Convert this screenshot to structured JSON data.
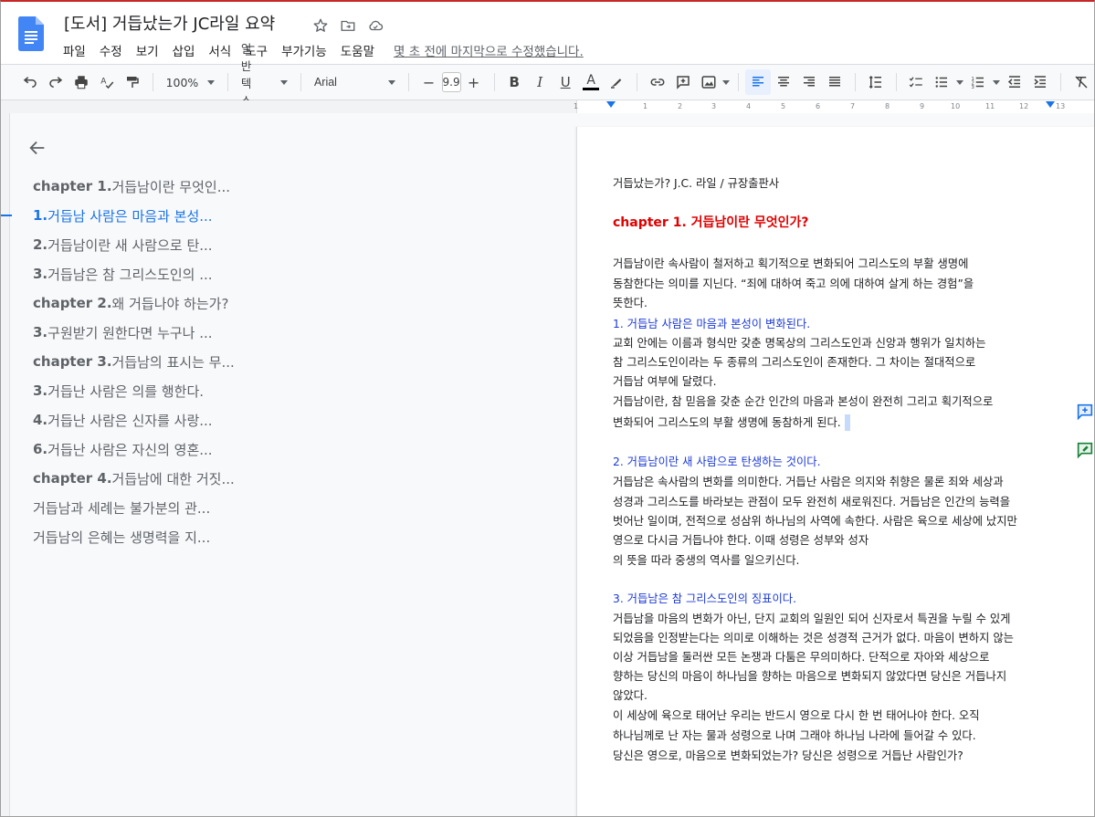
{
  "window": {
    "title": "[도서] 거듭났는가 JC라일 요약",
    "last_edit": "몇 초 전에 마지막으로 수정했습니다."
  },
  "menu": [
    "파일",
    "수정",
    "보기",
    "삽입",
    "서식",
    "도구",
    "부가기능",
    "도움말"
  ],
  "toolbar": {
    "zoom": "100%",
    "style": "일반 텍스트",
    "font": "Arial",
    "font_size": "9.9",
    "minus": "−",
    "plus": "+",
    "bold": "B",
    "italic": "I",
    "underline": "U",
    "text_color": "A"
  },
  "ruler": {
    "ticks": [
      "1",
      "1",
      "2",
      "3",
      "4",
      "5",
      "6",
      "7",
      "8",
      "9",
      "10",
      "11",
      "12",
      "13"
    ]
  },
  "outline": {
    "items": [
      {
        "prefix": "chapter 1.",
        "text": " 거듭남이란 무엇인...",
        "bold_prefix": true,
        "active": false
      },
      {
        "prefix": "1.",
        "text": " 거듭남 사람은 마음과 본성...",
        "bold_prefix": true,
        "active": true
      },
      {
        "prefix": "2.",
        "text": " 거듭남이란 새 사람으로 탄...",
        "bold_prefix": true,
        "active": false
      },
      {
        "prefix": "3.",
        "text": " 거듭남은 참 그리스도인의 ...",
        "bold_prefix": true,
        "active": false
      },
      {
        "prefix": "chapter 2.",
        "text": " 왜 거듭나야 하는가?",
        "bold_prefix": true,
        "active": false
      },
      {
        "prefix": "3.",
        "text": " 구원받기 원한다면 누구나 ...",
        "bold_prefix": true,
        "active": false
      },
      {
        "prefix": "chapter 3.",
        "text": " 거듭남의 표시는 무...",
        "bold_prefix": true,
        "active": false
      },
      {
        "prefix": "3.",
        "text": " 거듭난 사람은 의를 행한다.",
        "bold_prefix": true,
        "active": false
      },
      {
        "prefix": "4.",
        "text": " 거듭난 사람은 신자를 사랑...",
        "bold_prefix": true,
        "active": false
      },
      {
        "prefix": "6.",
        "text": " 거듭난 사람은 자신의 영혼...",
        "bold_prefix": true,
        "active": false
      },
      {
        "prefix": "chapter 4.",
        "text": " 거듭남에 대한 거짓...",
        "bold_prefix": true,
        "active": false
      },
      {
        "prefix": "",
        "text": "거듭남과 세례는 불가분의 관...",
        "bold_prefix": false,
        "active": false
      },
      {
        "prefix": "",
        "text": "거듭남의 은혜는 생명력을 지...",
        "bold_prefix": false,
        "active": false
      }
    ]
  },
  "document": {
    "lines": [
      {
        "text": "거듭났는가? J.C. 라일 / 규장출판사",
        "style": "normal"
      },
      {
        "text": "chapter 1. 거듭남이란 무엇인가?",
        "style": "red"
      },
      {
        "text": "거듭남이란 속사람이 철저하고 획기적으로 변화되어 그리스도의 부활 생명에",
        "style": "normal"
      },
      {
        "text": "동참한다는 의미를 지닌다. “죄에 대하여 죽고 의에 대하여 살게 하는 경험”을",
        "style": "normal"
      },
      {
        "text": "뜻한다.",
        "style": "normal"
      },
      {
        "text": "1. 거듭남 사람은 마음과 본성이 변화된다.",
        "style": "blue"
      },
      {
        "text": "교회 안에는 이름과 형식만 갖춘 명목상의 그리스도인과 신앙과 행위가 일치하는",
        "style": "normal"
      },
      {
        "text": "참 그리스도인이라는 두 종류의 그리스도인이 존재한다. 그 차이는 절대적으로",
        "style": "normal"
      },
      {
        "text": "거듭남 여부에 달렸다.",
        "style": "normal"
      },
      {
        "text": "거듭남이란, 참 믿음을 갖춘 순간 인간의 마음과 본성이 완전히 그리고 획기적으로",
        "style": "normal"
      },
      {
        "text": "변화되어 그리스도의 부활 생명에 동참하게 된다.",
        "style": "normal"
      },
      {
        "text": "2. 거듭남이란 새 사람으로 탄생하는 것이다.",
        "style": "blue"
      },
      {
        "text": "거듭남은 속사람의 변화를 의미한다. 거듭난 사람은 의지와 취향은 물론 죄와  세상과",
        "style": "normal"
      },
      {
        "text": "성경과 그리스도를 바라보는 관점이 모두 완전히 새로워진다. 거듭남은  인간의 능력을",
        "style": "normal"
      },
      {
        "text": "벗어난 일이며, 전적으로 성삼위 하나님의 사역에 속한다. 사람은  육으로 세상에 났지만",
        "style": "normal"
      },
      {
        "text": "영으로 다시금 거듭나야 한다. 이때 성령은 성부와 성자",
        "style": "normal"
      },
      {
        "text": "의 뜻을 따라 중생의 역사를 일으키신다.",
        "style": "normal"
      },
      {
        "text": "3. 거듭남은 참 그리스도인의 징표이다.",
        "style": "blue"
      },
      {
        "text": "거듭남을 마음의 변화가 아닌, 단지 교회의 일원인 되어 신자로서 특권을 누릴  수 있게",
        "style": "normal"
      },
      {
        "text": "되었음을 인정받는다는 의미로 이해하는 것은 성경적 근거가 없다. 마음이 변하지 않는",
        "style": "normal"
      },
      {
        "text": "이상 거듭남을 둘러싼 모든 논쟁과 다툼은 무의미하다. 단적으로 자아와 세상으로",
        "style": "normal"
      },
      {
        "text": "향하는 당신의 마음이 하나님을 향하는 마음으로 변화되지 않았다면 당신은 거듭나지",
        "style": "normal"
      },
      {
        "text": "않았다.",
        "style": "normal"
      },
      {
        "text": "이 세상에 육으로 태어난 우리는 반드시 영으로 다시 한 번 태어나야 한다. 오직",
        "style": "normal"
      },
      {
        "text": "하나님께로 난 자는 물과 성령으로 나며 그래야 하나님 나라에 들어갈 수 있다.",
        "style": "normal"
      },
      {
        "text": "당신은 영으로, 마음으로 변화되었는가? 당신은 성령으로 거듭난 사람인가?",
        "style": "normal"
      }
    ]
  },
  "colors": {
    "accent": "#1a73e8",
    "heading_red": "#e00000",
    "heading_blue": "#1c3ad6",
    "doc_icon": "#4285f4"
  },
  "icons": [
    "docs-logo-icon",
    "star-icon",
    "move-folder-icon",
    "cloud-status-icon",
    "undo-icon",
    "redo-icon",
    "print-icon",
    "spellcheck-icon",
    "paint-format-icon",
    "highlight-icon",
    "link-icon",
    "comment-icon",
    "image-icon",
    "align-left-icon",
    "align-center-icon",
    "align-right-icon",
    "justify-icon",
    "line-spacing-icon",
    "checklist-icon",
    "bullet-list-icon",
    "numbered-list-icon",
    "indent-decrease-icon",
    "indent-increase-icon",
    "clear-format-icon",
    "back-arrow-icon",
    "add-comment-side-icon",
    "suggest-edit-side-icon"
  ]
}
